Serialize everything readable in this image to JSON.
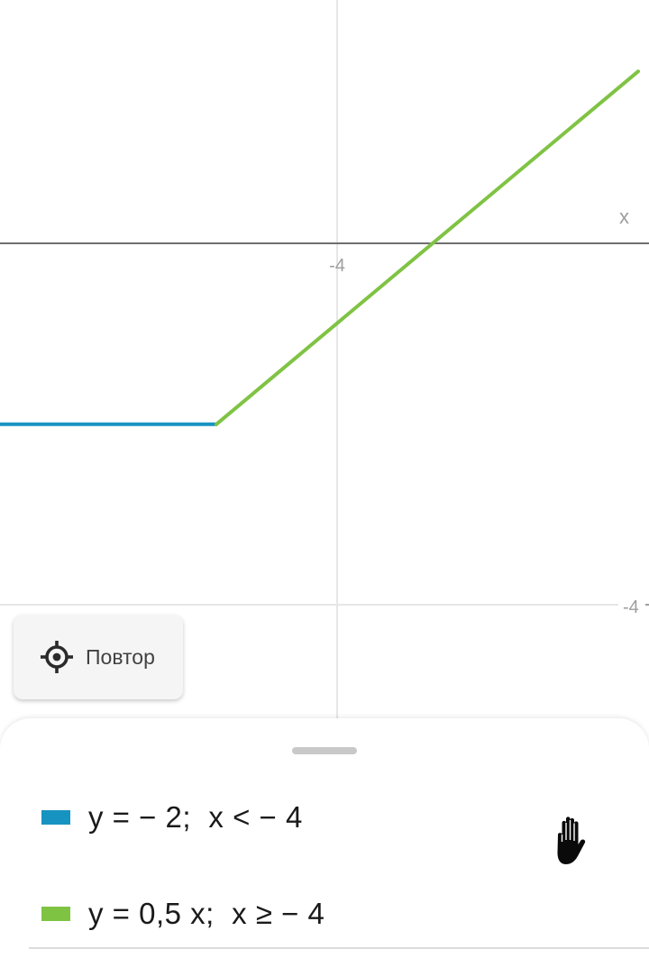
{
  "graph": {
    "x_axis_name": "x",
    "tick_labels": {
      "x_negative": "-4",
      "y_negative": "-4"
    },
    "colors": {
      "axis": "#6f6f6f",
      "grid": "#e6e6e6",
      "series1": "#1793c1",
      "series2": "#7fc343"
    }
  },
  "chart_data": {
    "type": "line",
    "x_axis_label": "x",
    "xlim": [
      -8,
      4
    ],
    "ylim": [
      -7.8,
      1.4
    ],
    "series": [
      {
        "name": "y = − 2;  x < − 4",
        "color": "#1793c1",
        "x": [
          -8,
          -4
        ],
        "y": [
          -2,
          -2
        ]
      },
      {
        "name": "y = 0,5 x;  x ≥ − 4",
        "color": "#7fc343",
        "x": [
          -4,
          3.8
        ],
        "y": [
          -2,
          1.9
        ]
      }
    ]
  },
  "controls": {
    "recenter_label": "Повтор",
    "recenter_icon": "crosshair-icon"
  },
  "legend": {
    "items": [
      {
        "formula": "y = − 2;  x < − 4",
        "color": "#1793c1"
      },
      {
        "formula": "y = 0,5 x;  x ≥ − 4",
        "color": "#7fc343"
      }
    ],
    "drag_handle": "drag-handle",
    "hand_icon": "hand-icon"
  }
}
